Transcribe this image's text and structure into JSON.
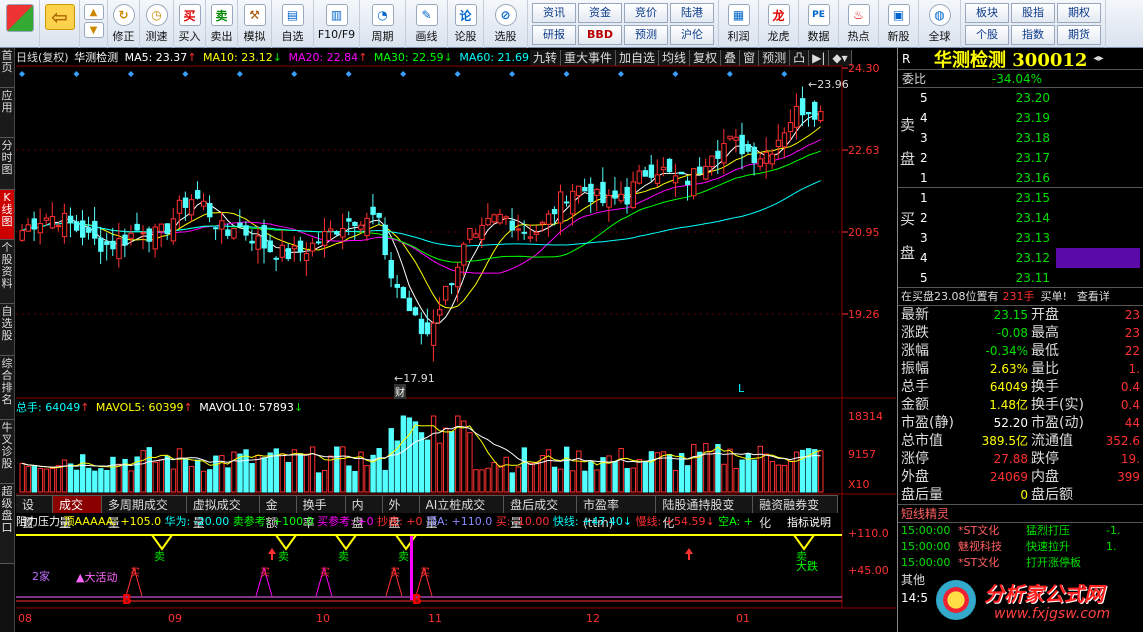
{
  "toolbar": {
    "big": [
      {
        "label": "修正"
      },
      {
        "label": "测速"
      }
    ],
    "buttons": [
      {
        "label": "买入"
      },
      {
        "label": "卖出"
      },
      {
        "label": "模拟"
      },
      {
        "label": "自选"
      },
      {
        "label": "F10/F9"
      },
      {
        "label": "周期"
      },
      {
        "label": "画线"
      },
      {
        "label": "论股"
      },
      {
        "label": "选股"
      }
    ],
    "grid1": [
      "资讯",
      "资金",
      "竞价",
      "陆港",
      "研报",
      "BBD",
      "预测",
      "沪伦"
    ],
    "right": [
      {
        "label": "利润"
      },
      {
        "label": "龙虎"
      },
      {
        "label": "数据"
      },
      {
        "label": "热点"
      },
      {
        "label": "新股"
      },
      {
        "label": "全球"
      }
    ],
    "grid2": [
      "板块",
      "股指",
      "期权",
      "个股",
      "指数",
      "期货"
    ]
  },
  "leftbar": [
    {
      "label": "首页"
    },
    {
      "label": "应用"
    },
    {
      "label": "分时图"
    },
    {
      "label": "K线图",
      "active": true
    },
    {
      "label": "个股资料"
    },
    {
      "label": "自选股"
    },
    {
      "label": "综合排名"
    },
    {
      "label": "牛叉诊股"
    },
    {
      "label": "超级盘口"
    }
  ],
  "kline": {
    "title": "日线(复权)",
    "name": "华测检测",
    "mas": [
      {
        "label": "MA5: 23.37",
        "color": "#ffffff",
        "arrow": "↑"
      },
      {
        "label": "MA10: 23.12",
        "color": "#ffff00",
        "arrow": "↓"
      },
      {
        "label": "MA20: 22.84",
        "color": "#ff00ff",
        "arrow": "↑"
      },
      {
        "label": "MA30: 22.59",
        "color": "#00ff00",
        "arrow": "↓"
      },
      {
        "label": "MA60: 21.69",
        "color": "#00ffff",
        "arrow": ""
      }
    ],
    "tabs": [
      "九转",
      "重大事件",
      "加自选",
      "均线",
      "复权",
      "叠",
      "窗",
      "预测",
      "凸"
    ],
    "price_axis": [
      "24.30",
      "22.63",
      "20.95",
      "19.26"
    ],
    "high_label": "23.96",
    "low_label": "17.91",
    "marker_cai": "财",
    "marker_l": "L"
  },
  "volume": {
    "title": "总手: 64049",
    "arrow1": "↑",
    "mavol5": "MAVOL5: 60399",
    "arrow2": "↑",
    "mavol10": "MAVOL10: 57893",
    "arrow3": "↓",
    "axis": [
      "18314",
      "9157",
      "X10"
    ]
  },
  "subtabs": [
    {
      "label": "设置"
    },
    {
      "label": "成交量",
      "active": true
    },
    {
      "label": "多周期成交量"
    },
    {
      "label": "虚拟成交量"
    },
    {
      "label": "金额"
    },
    {
      "label": "换手率"
    },
    {
      "label": "内盘"
    },
    {
      "label": "外盘"
    },
    {
      "label": "AI立桩成交量"
    },
    {
      "label": "盘后成交量"
    },
    {
      "label": "市盈率(ttm)"
    },
    {
      "label": "陆股通持股变化"
    },
    {
      "label": "融资融券变化"
    }
  ],
  "indicator": {
    "name": "阻力压力",
    "items": [
      {
        "text": "顶AAAAA: +105.0",
        "color": "#ffff00"
      },
      {
        "text": "华为: -20.00",
        "color": "#00ffff"
      },
      {
        "text": "卖参考: +100.0",
        "color": "#00ff00"
      },
      {
        "text": "买参考: +0",
        "color": "#ff00ff"
      },
      {
        "text": "抄底: +0",
        "color": "#ff3030"
      },
      {
        "text": "顶A: +110.0",
        "color": "#8888ff"
      },
      {
        "text": "买: -10.00",
        "color": "#ff3030"
      },
      {
        "text": "快线: +47.40↓",
        "color": "#00ffff"
      },
      {
        "text": "慢线: +54.59↓",
        "color": "#ff3030"
      },
      {
        "text": "空A: +",
        "color": "#00ff00"
      }
    ],
    "explain": "指标说明",
    "axis": [
      "+110.0",
      "+45.00"
    ],
    "labels": {
      "a": "2家",
      "b": "大活动",
      "c": "卖",
      "d": "大跌",
      "e": "B",
      "f": "B"
    }
  },
  "dates": [
    "08",
    "09",
    "10",
    "11",
    "12",
    "01"
  ],
  "right": {
    "r": "R",
    "title": "华测检测 300012",
    "webi_label": "委比",
    "webi": "-34.04%",
    "sell_label": "卖盘",
    "buy_label": "买盘",
    "sells": [
      {
        "n": "5",
        "p": "23.20"
      },
      {
        "n": "4",
        "p": "23.19"
      },
      {
        "n": "3",
        "p": "23.18"
      },
      {
        "n": "2",
        "p": "23.17"
      },
      {
        "n": "1",
        "p": "23.16"
      }
    ],
    "buys": [
      {
        "n": "1",
        "p": "23.15"
      },
      {
        "n": "2",
        "p": "23.14"
      },
      {
        "n": "3",
        "p": "23.13"
      },
      {
        "n": "4",
        "p": "23.12"
      },
      {
        "n": "5",
        "p": "23.11"
      }
    ],
    "notice": {
      "a": "在买盘23.08位置有",
      "b": "231手",
      "c": "买单!",
      "d": "查看详"
    },
    "stats": [
      {
        "l1": "最新",
        "v1": "23.15",
        "c1": "#00e000",
        "l2": "开盘",
        "v2": "23"
      },
      {
        "l1": "涨跌",
        "v1": "-0.08",
        "c1": "#00e000",
        "l2": "最高",
        "v2": "23"
      },
      {
        "l1": "涨幅",
        "v1": "-0.34%",
        "c1": "#00e000",
        "l2": "最低",
        "v2": "22"
      },
      {
        "l1": "振幅",
        "v1": "2.63%",
        "c1": "#ffff00",
        "l2": "量比",
        "v2": "1."
      },
      {
        "l1": "总手",
        "v1": "64049",
        "c1": "#ffff00",
        "l2": "换手",
        "v2": "0.4"
      },
      {
        "l1": "金额",
        "v1": "1.48亿",
        "c1": "#ffff00",
        "l2": "换手(实)",
        "v2": "0.4"
      },
      {
        "l1": "市盈(静)",
        "v1": "52.20",
        "c1": "#ffffff",
        "l2": "市盈(动)",
        "v2": "44"
      },
      {
        "l1": "总市值",
        "v1": "389.5亿",
        "c1": "#ffff00",
        "l2": "流通值",
        "v2": "352.6"
      },
      {
        "l1": "涨停",
        "v1": "27.88",
        "c1": "#ff3030",
        "l2": "跌停",
        "v2": "19."
      },
      {
        "l1": "外盘",
        "v1": "24069",
        "c1": "#ff3030",
        "l2": "内盘",
        "v2": "399"
      },
      {
        "l1": "盘后量",
        "v1": "0",
        "c1": "#ffff00",
        "l2": "盘后额",
        "v2": ""
      }
    ],
    "short_title": "短线精灵",
    "short": [
      {
        "t": "15:00:00",
        "s": "*ST文化",
        "e": "猛烈打压",
        "v": "-1."
      },
      {
        "t": "15:00:00",
        "s": "魅视科技",
        "e": "快速拉升",
        "v": "1."
      },
      {
        "t": "15:00:00",
        "s": "*ST文化",
        "e": "打开涨停板",
        "v": ""
      }
    ],
    "other": "其他",
    "time": "14:5"
  },
  "watermark": {
    "name": "分析家公式网",
    "url": "www.fxjgsw.com"
  },
  "colors": {
    "up": "#ff3030",
    "down": "#54ffff",
    "ma5": "#ffffff",
    "ma10": "#ffff00",
    "ma20": "#ff00ff",
    "ma30": "#00ff00",
    "ma60": "#00ffff"
  }
}
